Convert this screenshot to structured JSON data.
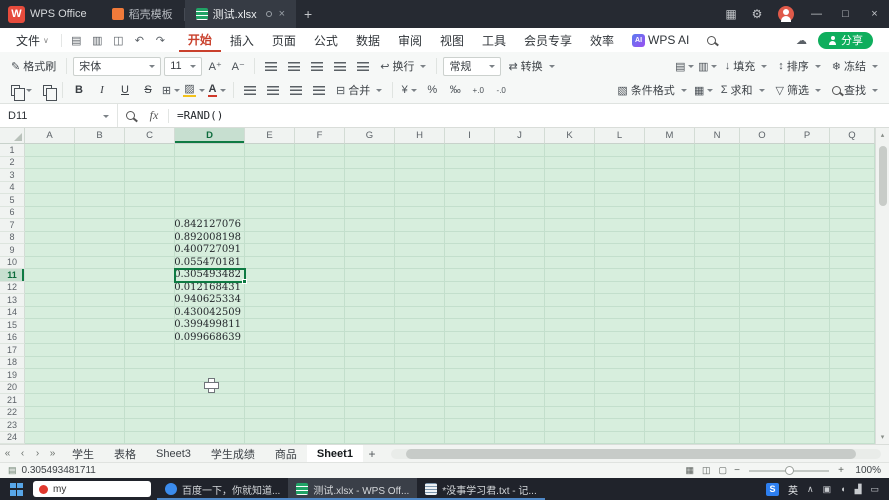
{
  "titlebar": {
    "app_name": "WPS Office",
    "doc_tabs": [
      {
        "label": "稻壳模板",
        "icon": "docer",
        "active": false
      },
      {
        "label": "测试.xlsx",
        "icon": "sheet",
        "active": true
      }
    ]
  },
  "menubar": {
    "file": "文件",
    "tabs": [
      {
        "key": "home",
        "label": "开始",
        "active": true
      },
      {
        "key": "insert",
        "label": "插入"
      },
      {
        "key": "page",
        "label": "页面"
      },
      {
        "key": "formula",
        "label": "公式"
      },
      {
        "key": "data",
        "label": "数据"
      },
      {
        "key": "review",
        "label": "审阅"
      },
      {
        "key": "view",
        "label": "视图"
      },
      {
        "key": "tools",
        "label": "工具"
      },
      {
        "key": "member",
        "label": "会员专享"
      },
      {
        "key": "efficiency",
        "label": "效率"
      },
      {
        "key": "wps-ai",
        "label": "WPS AI",
        "ai_badge": true
      }
    ],
    "share": "分享"
  },
  "ribbon": {
    "format_painter": "格式刷",
    "font_name": "宋体",
    "font_size": "11",
    "wrap_label": "换行",
    "number_format": "常规",
    "convert_label": "转换",
    "fill_label": "填充",
    "sort_label": "排序",
    "freeze_label": "冻结",
    "merge_label": "合并",
    "conditional_format_label": "条件格式",
    "sum_label": "求和",
    "filter_label": "筛选",
    "find_label": "查找",
    "bold": "B",
    "italic": "I",
    "underline": "U"
  },
  "formula_bar": {
    "name_box": "D11",
    "fx": "fx",
    "formula": "=RAND()"
  },
  "grid": {
    "columns": [
      "A",
      "B",
      "C",
      "D",
      "E",
      "F",
      "G",
      "H",
      "I",
      "J",
      "K",
      "L",
      "M",
      "N",
      "O",
      "P",
      "Q"
    ],
    "row_count": 24,
    "row_height": 12.5,
    "row_header_width": 25,
    "col_widths": {
      "default": 50,
      "D": 70,
      "N": 45,
      "O": 45,
      "P": 45,
      "Q": 45
    },
    "selected_cell": {
      "col": "D",
      "row": 11
    },
    "cells": [
      {
        "ref": "D7",
        "value": "0.842127076"
      },
      {
        "ref": "D8",
        "value": "0.892008198"
      },
      {
        "ref": "D9",
        "value": "0.400727091"
      },
      {
        "ref": "D10",
        "value": "0.055470181"
      },
      {
        "ref": "D11",
        "value": "0.305493482"
      },
      {
        "ref": "D12",
        "value": "0.012168431"
      },
      {
        "ref": "D13",
        "value": "0.940625334"
      },
      {
        "ref": "D14",
        "value": "0.430042509"
      },
      {
        "ref": "D15",
        "value": "0.399499811"
      },
      {
        "ref": "D16",
        "value": "0.099668639"
      }
    ]
  },
  "sheet_tabs": {
    "tabs": [
      {
        "key": "xuesheng",
        "label": "学生"
      },
      {
        "key": "biaoge",
        "label": "表格"
      },
      {
        "key": "sheet3",
        "label": "Sheet3"
      },
      {
        "key": "xueshengchengji",
        "label": "学生成绩"
      },
      {
        "key": "shangpin",
        "label": "商品"
      },
      {
        "key": "sheet1",
        "label": "Sheet1",
        "active": true
      }
    ]
  },
  "status_bar": {
    "value": "0.305493481711",
    "zoom_percent": "100%"
  },
  "taskbar": {
    "search_text": "my",
    "apps": [
      {
        "key": "browser",
        "icon": "browser",
        "label": "百度一下，你就知道..."
      },
      {
        "key": "wps",
        "icon": "wps",
        "label": "测试.xlsx - WPS Off...",
        "active": true
      },
      {
        "key": "notepad",
        "icon": "notepad",
        "label": "*没事学习君.txt - 记..."
      }
    ],
    "input_method": "S",
    "input_lang": "英",
    "tray": [
      {
        "name": "hidden-icons-chevron",
        "glyph": "∧"
      },
      {
        "name": "security-shield-icon",
        "glyph": "▣"
      },
      {
        "name": "volume-icon",
        "glyph": "◖"
      },
      {
        "name": "network-icon",
        "glyph": "▟"
      },
      {
        "name": "battery-icon",
        "glyph": "▭"
      }
    ]
  },
  "icons": {
    "brush": "✎",
    "save": "▤",
    "print": "▥",
    "preview": "◫",
    "undo": "↶",
    "redo": "↷",
    "apps_grid": "▦",
    "settings": "⚙",
    "cloud": "☁",
    "minimize": "—",
    "maximize": "□",
    "close": "×",
    "tab_close": "×",
    "new_tab": "+",
    "font_inc": "A⁺",
    "font_dec": "A⁻",
    "wrap": "↩",
    "convert": "⇄",
    "rows_cols": "▤",
    "worksheet": "▥",
    "fill": "↓",
    "sort": "↕",
    "freeze": "❄",
    "borders": "⊞",
    "shading": "▨",
    "merge": "⊟",
    "currency": "¥",
    "percent": "%",
    "permille": "‰",
    "dec_inc": "+.0",
    "dec_dec": "-.0",
    "cond_fmt": "▧",
    "table_style": "▦",
    "sum": "Σ",
    "filter": "▽",
    "strike": "S",
    "nav_first": "«",
    "nav_prev": "‹",
    "nav_next": "›",
    "nav_last": "»",
    "scroll_up": "▴",
    "scroll_down": "▾",
    "view_normal": "▦",
    "view_page": "◫",
    "view_read": "▢",
    "zoom_out": "−",
    "zoom_in": "+",
    "add_sheet": "+",
    "status": "▤"
  },
  "colors": {
    "accent_green": "#0f7b43",
    "menu_red": "#c9402c",
    "share_green": "#0fae5d",
    "grid_bg": "#d7eedd"
  }
}
